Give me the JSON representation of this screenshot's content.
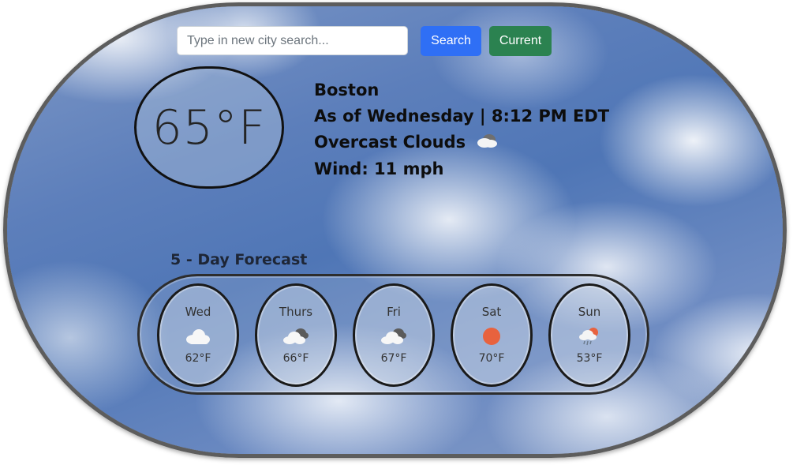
{
  "search": {
    "placeholder": "Type in new city search...",
    "value": "",
    "search_label": "Search",
    "current_label": "Current"
  },
  "current": {
    "temperature": "65°F",
    "city": "Boston",
    "as_of": "As of Wednesday | 8:12 PM EDT",
    "condition": "Overcast Clouds",
    "condition_icon": "overcast-cloud-icon",
    "wind": "Wind: 11 mph"
  },
  "forecast": {
    "title": "5 - Day Forecast",
    "days": [
      {
        "name": "Wed",
        "icon": "cloud-icon",
        "temp": "62°F"
      },
      {
        "name": "Thurs",
        "icon": "broken-clouds-icon",
        "temp": "66°F"
      },
      {
        "name": "Fri",
        "icon": "broken-clouds-icon",
        "temp": "67°F"
      },
      {
        "name": "Sat",
        "icon": "sun-icon",
        "temp": "70°F"
      },
      {
        "name": "Sun",
        "icon": "rain-sun-icon",
        "temp": "53°F"
      }
    ]
  },
  "colors": {
    "search_button": "#2f6ff5",
    "current_button": "#2b8250",
    "sun": "#e8623e"
  }
}
